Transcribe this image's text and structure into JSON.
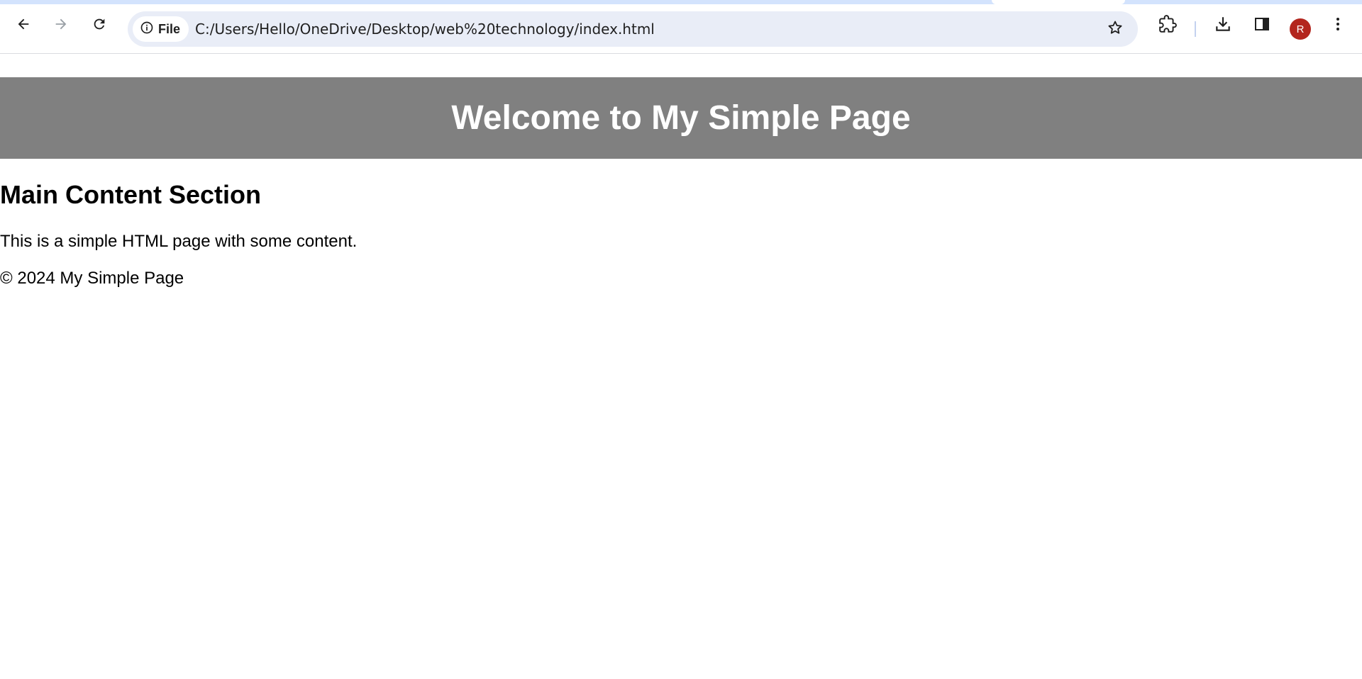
{
  "browser": {
    "address_bar": {
      "site_chip_label": "File",
      "url": "C:/Users/Hello/OneDrive/Desktop/web%20technology/index.html"
    },
    "profile_avatar_letter": "R",
    "colors": {
      "tabstrip": "#d3e3fd",
      "omnibox_bg": "#e9edf7",
      "avatar_bg": "#b3261e"
    },
    "icons": [
      "back-arrow-icon",
      "forward-arrow-icon",
      "reload-icon",
      "info-icon",
      "star-icon",
      "extensions-icon",
      "download-icon",
      "side-panel-icon",
      "more-vert-icon"
    ]
  },
  "page": {
    "header": {
      "title": "Welcome to My Simple Page",
      "background": "#808080"
    },
    "main": {
      "heading": "Main Content Section",
      "paragraph": "This is a simple HTML page with some content."
    },
    "footer": {
      "text": "© 2024 My Simple Page"
    }
  }
}
